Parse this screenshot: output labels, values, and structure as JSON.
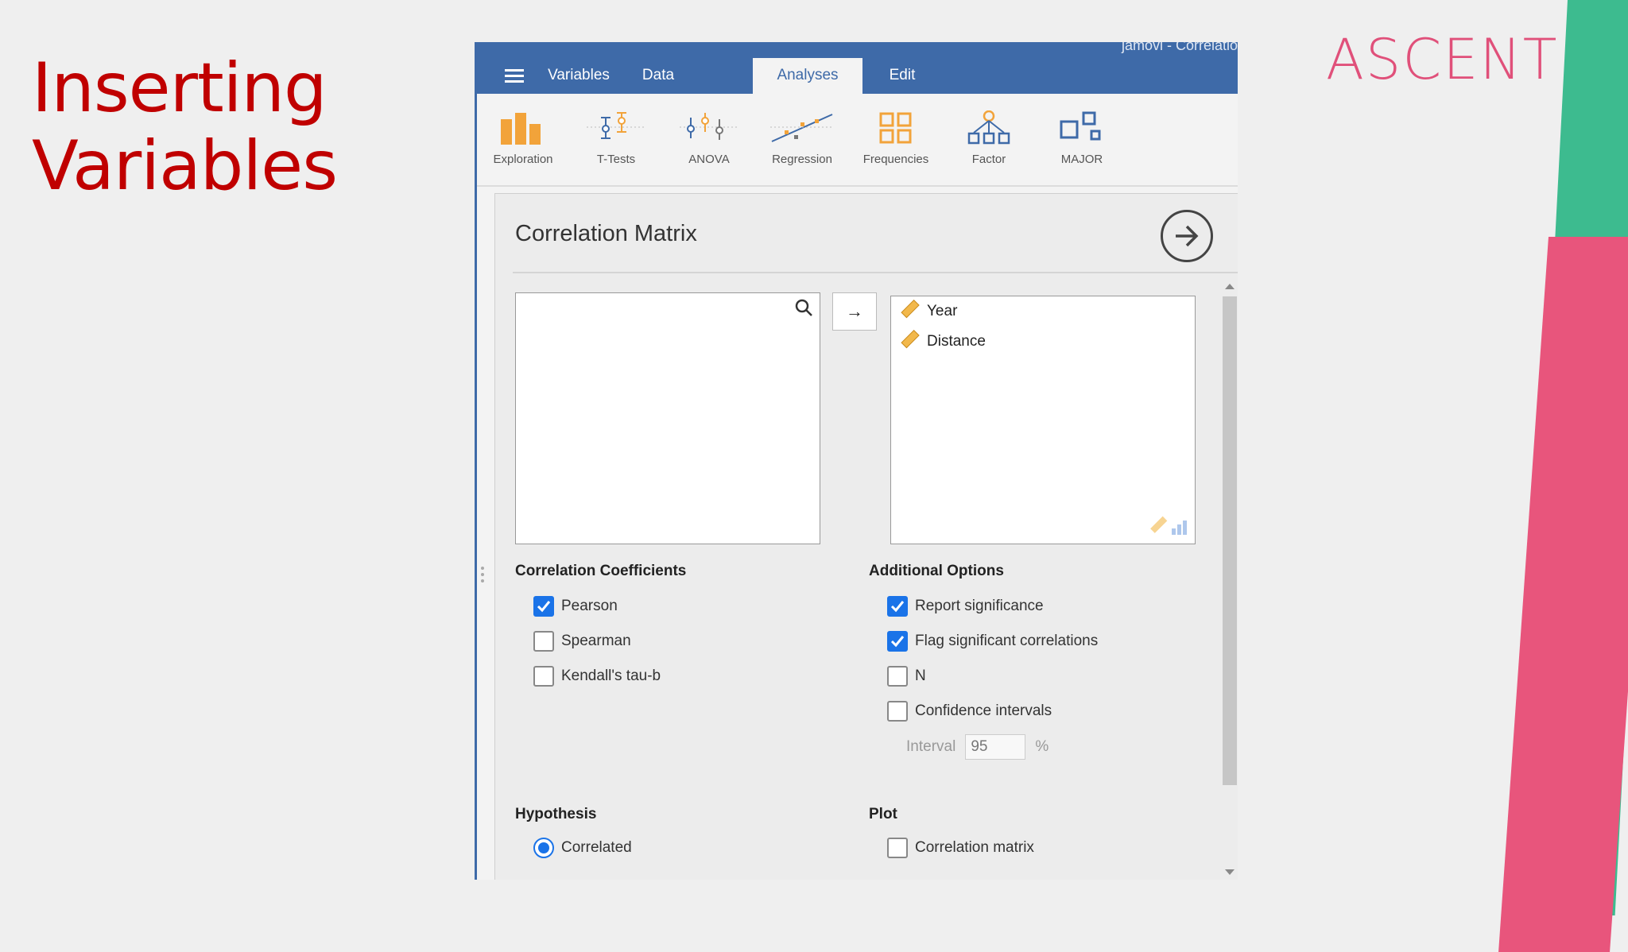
{
  "slide": {
    "title_line1": "Inserting",
    "title_line2": "Variables",
    "logo": "ASCENT"
  },
  "app": {
    "window_title": "jamovi - Correlatio",
    "tabs": [
      {
        "label": "Variables"
      },
      {
        "label": "Data"
      },
      {
        "label": "Analyses"
      },
      {
        "label": "Edit"
      }
    ],
    "active_tab": "Analyses",
    "toolbar": [
      {
        "label": "Exploration",
        "icon": "bar-chart-icon"
      },
      {
        "label": "T-Tests",
        "icon": "t-tests-icon"
      },
      {
        "label": "ANOVA",
        "icon": "anova-icon"
      },
      {
        "label": "Regression",
        "icon": "regression-icon"
      },
      {
        "label": "Frequencies",
        "icon": "frequencies-icon"
      },
      {
        "label": "Factor",
        "icon": "factor-icon"
      },
      {
        "label": "MAJOR",
        "icon": "module-icon"
      }
    ]
  },
  "analysis": {
    "title": "Correlation Matrix",
    "move_button": "→",
    "selected_variables": [
      {
        "name": "Year"
      },
      {
        "name": "Distance"
      }
    ],
    "correlation_coefficients": {
      "heading": "Correlation Coefficients",
      "options": [
        {
          "label": "Pearson",
          "checked": true
        },
        {
          "label": "Spearman",
          "checked": false
        },
        {
          "label": "Kendall's tau-b",
          "checked": false
        }
      ]
    },
    "additional_options": {
      "heading": "Additional Options",
      "options": [
        {
          "label": "Report significance",
          "checked": true
        },
        {
          "label": "Flag significant correlations",
          "checked": true
        },
        {
          "label": "N",
          "checked": false
        },
        {
          "label": "Confidence intervals",
          "checked": false
        }
      ],
      "interval_label": "Interval",
      "interval_value": "95",
      "interval_unit": "%"
    },
    "hypothesis": {
      "heading": "Hypothesis",
      "selected": "Correlated"
    },
    "plot": {
      "heading": "Plot",
      "correlation_matrix_label": "Correlation matrix",
      "checked": false
    }
  },
  "colors": {
    "accent": "#3e6aa8",
    "checkbox": "#1a73e8",
    "title_red": "#c00000",
    "logo_pink": "#e0507a",
    "stripe_green": "#3dbb8f",
    "stripe_pink": "#e8557c"
  }
}
